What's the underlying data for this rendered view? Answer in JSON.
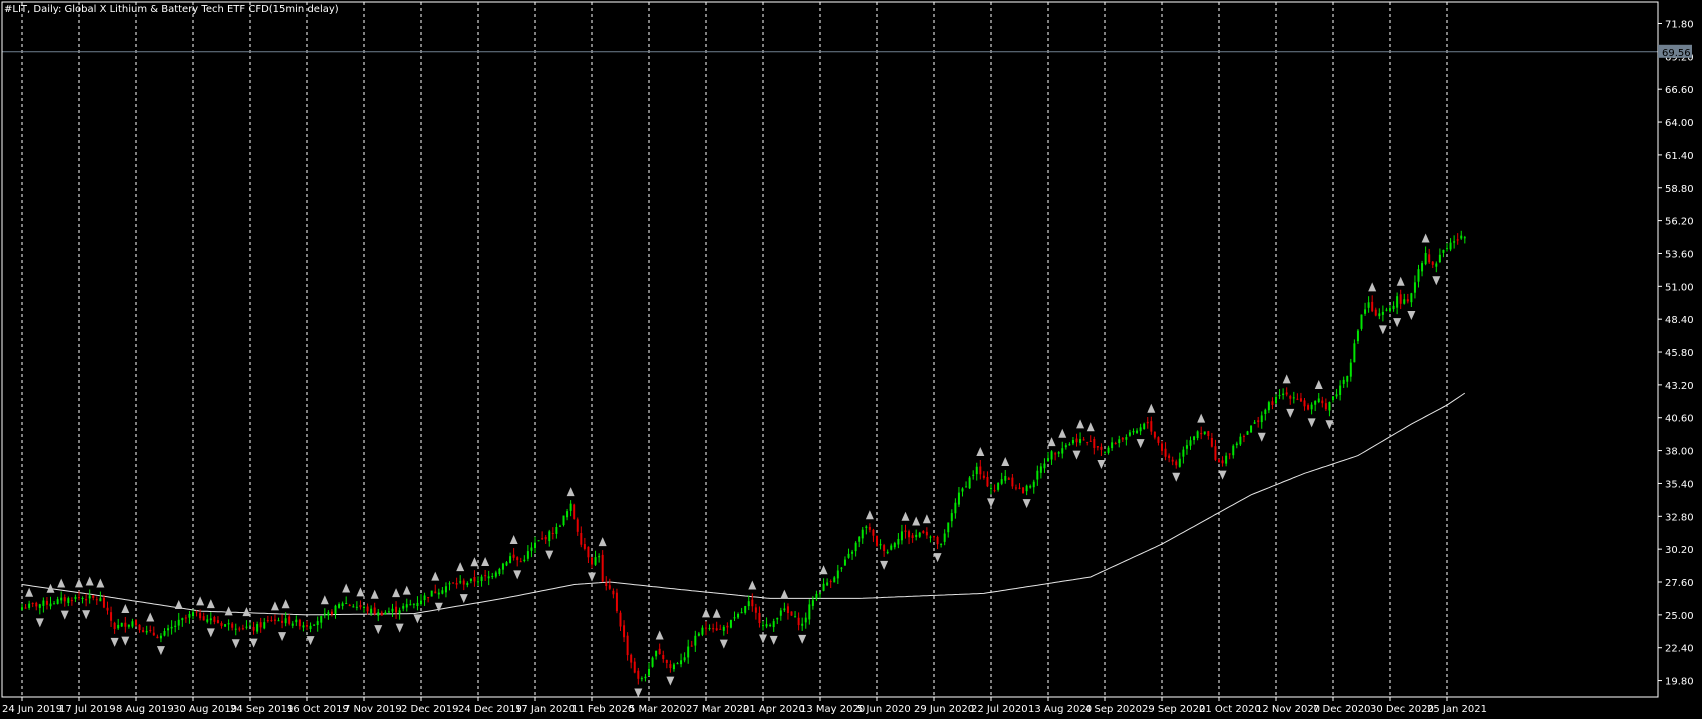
{
  "window": {
    "title": "#LIT, Daily:  Global X Lithium & Battery Tech ETF CFD(15min delay)",
    "current_price_label": "69.56"
  },
  "colors": {
    "background": "#000000",
    "frame": "#ffffff",
    "grid": "#ffffff",
    "bull": "#00e600",
    "bear": "#e60000",
    "moving_average": "#e6e6e6",
    "price_line": "#708090",
    "fractal": "#c0c0c0"
  },
  "chart_data": {
    "type": "candlestick",
    "symbol": "#LIT",
    "timeframe": "Daily",
    "ylim": [
      18.5,
      73.5
    ],
    "y_ticks": [
      "71.80",
      "69.20",
      "66.60",
      "64.00",
      "61.40",
      "58.80",
      "56.20",
      "53.60",
      "51.00",
      "48.40",
      "45.80",
      "43.20",
      "40.60",
      "38.00",
      "35.40",
      "32.80",
      "30.20",
      "27.60",
      "25.00",
      "22.40",
      "19.80"
    ],
    "x_labels": [
      "24 Jun 2019",
      "17 Jul 2019",
      "8 Aug 2019",
      "30 Aug 2019",
      "24 Sep 2019",
      "16 Oct 2019",
      "7 Nov 2019",
      "2 Dec 2019",
      "24 Dec 2019",
      "17 Jan 2020",
      "11 Feb 2020",
      "5 Mar 2020",
      "27 Mar 2020",
      "21 Apr 2020",
      "13 May 2020",
      "5 Jun 2020",
      "29 Jun 2020",
      "22 Jul 2020",
      "13 Aug 2020",
      "4 Sep 2020",
      "29 Sep 2020",
      "21 Oct 2020",
      "12 Nov 2020",
      "7 Dec 2020",
      "30 Dec 2020",
      "25 Jan 2021"
    ],
    "bars_between_labels": 16,
    "bars_after_last_label": 5,
    "current_price": 69.56,
    "grid": "vertical dashed",
    "close_path": [
      [
        0,
        25.6
      ],
      [
        6,
        25.9
      ],
      [
        16,
        26.4
      ],
      [
        22,
        26.2
      ],
      [
        26,
        24.0
      ],
      [
        31,
        24.5
      ],
      [
        35,
        23.6
      ],
      [
        39,
        23.3
      ],
      [
        44,
        24.4
      ],
      [
        48,
        25.1
      ],
      [
        56,
        24.3
      ],
      [
        61,
        24.1
      ],
      [
        65,
        23.9
      ],
      [
        70,
        24.6
      ],
      [
        75,
        24.5
      ],
      [
        80,
        24.2
      ],
      [
        86,
        25.0
      ],
      [
        90,
        26.0
      ],
      [
        95,
        25.6
      ],
      [
        100,
        25.1
      ],
      [
        105,
        25.4
      ],
      [
        110,
        25.9
      ],
      [
        114,
        26.6
      ],
      [
        120,
        27.4
      ],
      [
        125,
        27.6
      ],
      [
        131,
        28.0
      ],
      [
        137,
        29.6
      ],
      [
        140,
        29.2
      ],
      [
        144,
        30.6
      ],
      [
        148,
        31.4
      ],
      [
        150,
        31.8
      ],
      [
        154,
        33.6
      ],
      [
        157,
        30.8
      ],
      [
        160,
        29.2
      ],
      [
        162,
        29.8
      ],
      [
        163,
        27.5
      ],
      [
        166,
        26.5
      ],
      [
        170,
        22.0
      ],
      [
        173,
        19.8
      ],
      [
        176,
        20.5
      ],
      [
        178,
        22.4
      ],
      [
        182,
        20.8
      ],
      [
        186,
        21.8
      ],
      [
        190,
        23.6
      ],
      [
        193,
        24.2
      ],
      [
        196,
        23.8
      ],
      [
        200,
        24.6
      ],
      [
        204,
        25.9
      ],
      [
        207,
        24.6
      ],
      [
        210,
        24.0
      ],
      [
        213,
        25.5
      ],
      [
        216,
        24.9
      ],
      [
        219,
        24.2
      ],
      [
        222,
        26.3
      ],
      [
        225,
        27.3
      ],
      [
        230,
        28.7
      ],
      [
        234,
        30.6
      ],
      [
        237,
        32.1
      ],
      [
        240,
        30.6
      ],
      [
        243,
        30.1
      ],
      [
        247,
        31.6
      ],
      [
        250,
        31.1
      ],
      [
        253,
        31.7
      ],
      [
        258,
        30.4
      ],
      [
        262,
        34.0
      ],
      [
        265,
        35.4
      ],
      [
        268,
        36.6
      ],
      [
        270,
        35.6
      ],
      [
        273,
        34.9
      ],
      [
        276,
        36.1
      ],
      [
        278,
        35.4
      ],
      [
        281,
        34.7
      ],
      [
        284,
        35.7
      ],
      [
        288,
        37.6
      ],
      [
        292,
        38.3
      ],
      [
        296,
        38.9
      ],
      [
        300,
        38.6
      ],
      [
        304,
        38.0
      ],
      [
        308,
        38.9
      ],
      [
        312,
        39.3
      ],
      [
        316,
        40.2
      ],
      [
        318,
        39.1
      ],
      [
        321,
        37.6
      ],
      [
        324,
        36.9
      ],
      [
        327,
        38.6
      ],
      [
        330,
        39.6
      ],
      [
        333,
        39.1
      ],
      [
        335,
        37.2
      ],
      [
        337,
        36.9
      ],
      [
        339,
        38.0
      ],
      [
        342,
        39.1
      ],
      [
        346,
        40.1
      ],
      [
        350,
        41.6
      ],
      [
        354,
        42.5
      ],
      [
        358,
        42.2
      ],
      [
        361,
        41.3
      ],
      [
        364,
        41.9
      ],
      [
        366,
        41.5
      ],
      [
        369,
        42.6
      ],
      [
        372,
        44.1
      ],
      [
        374,
        46.3
      ],
      [
        376,
        48.8
      ],
      [
        378,
        49.6
      ],
      [
        380,
        48.5
      ],
      [
        383,
        49.0
      ],
      [
        386,
        50.0
      ],
      [
        389,
        49.6
      ],
      [
        392,
        52.4
      ],
      [
        394,
        53.7
      ],
      [
        396,
        52.5
      ],
      [
        399,
        53.9
      ],
      [
        402,
        54.6
      ],
      [
        405,
        54.9
      ],
      [
        408,
        54.6
      ],
      [
        411,
        56.8
      ],
      [
        414,
        58.1
      ],
      [
        417,
        59.6
      ],
      [
        420,
        61.4
      ],
      [
        421,
        60.1
      ],
      [
        422,
        66.6
      ],
      [
        424,
        71.7
      ],
      [
        427,
        69.5
      ],
      [
        430,
        70.6
      ],
      [
        432,
        68.0
      ],
      [
        434,
        70.3
      ],
      [
        436,
        71.7
      ],
      [
        438,
        71.1
      ],
      [
        440,
        67.4
      ],
      [
        442,
        65.0
      ],
      [
        443,
        66.8
      ],
      [
        444,
        69.4
      ]
    ],
    "moving_average": [
      [
        0,
        27.4
      ],
      [
        20,
        26.6
      ],
      [
        50,
        25.3
      ],
      [
        80,
        25.0
      ],
      [
        110,
        25.1
      ],
      [
        135,
        26.3
      ],
      [
        155,
        27.4
      ],
      [
        165,
        27.6
      ],
      [
        185,
        27.0
      ],
      [
        210,
        26.3
      ],
      [
        235,
        26.3
      ],
      [
        270,
        26.7
      ],
      [
        300,
        28.0
      ],
      [
        320,
        30.6
      ],
      [
        345,
        34.5
      ],
      [
        360,
        36.2
      ],
      [
        375,
        37.6
      ],
      [
        390,
        40.1
      ],
      [
        400,
        41.6
      ],
      [
        410,
        43.5
      ],
      [
        420,
        46.1
      ],
      [
        430,
        49.6
      ],
      [
        444,
        52.2
      ]
    ]
  }
}
